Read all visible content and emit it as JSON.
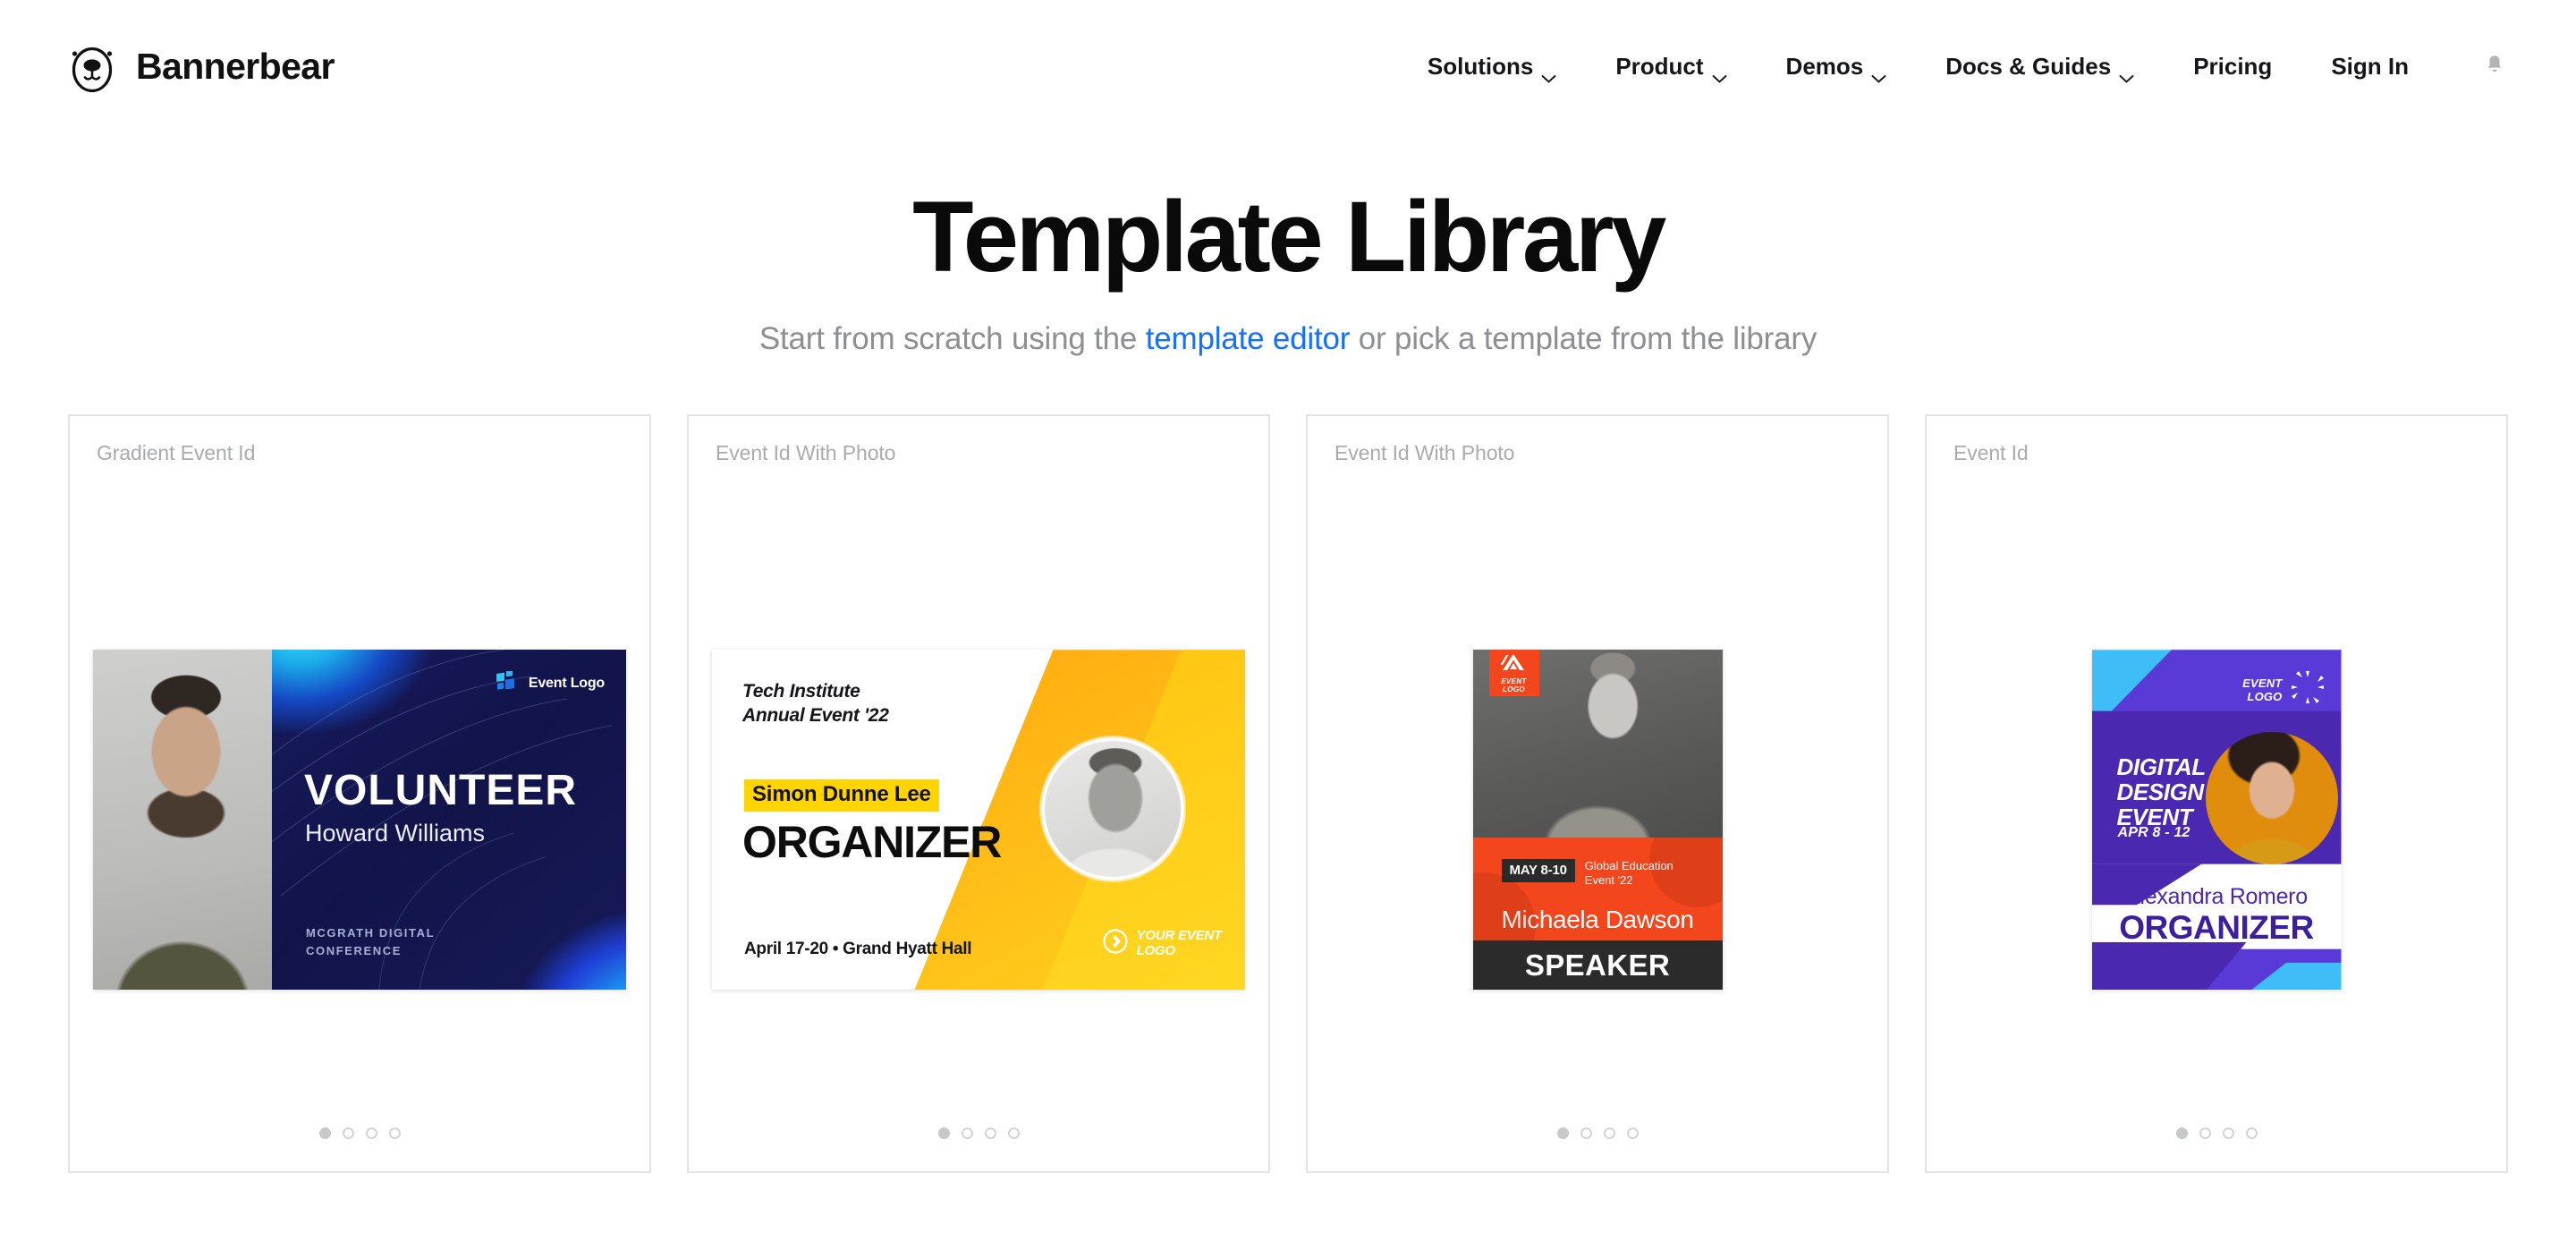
{
  "header": {
    "brand_name": "Bannerbear",
    "brand_logo_icon": "bear-head-icon",
    "nav": [
      {
        "label": "Solutions",
        "has_dropdown": true
      },
      {
        "label": "Product",
        "has_dropdown": true
      },
      {
        "label": "Demos",
        "has_dropdown": true
      },
      {
        "label": "Docs & Guides",
        "has_dropdown": true
      },
      {
        "label": "Pricing",
        "has_dropdown": false
      },
      {
        "label": "Sign In",
        "has_dropdown": false
      }
    ],
    "notification_icon": "bell-icon"
  },
  "hero": {
    "title": "Template Library",
    "subtitle_before": "Start from scratch using the ",
    "subtitle_link": "template editor",
    "subtitle_after": " or pick a template from the library"
  },
  "colors": {
    "link": "#1470ff",
    "text_primary": "#0a0a0a",
    "text_muted": "#8d8f93",
    "card_border": "#e3e4e6",
    "card_title": "#a9abae",
    "dot_active": "#c6c8ca",
    "t1_navy": "#121449",
    "t1_cyan": "#2fd4f5",
    "t2_yellow": "#ffd400",
    "t2_orange": "#ff9d0b",
    "t3_orange": "#f4461c",
    "t3_dark": "#2b2b2b",
    "t4_purple": "#4a28b0",
    "t4_violet": "#5a3ad6",
    "t4_cyan": "#3fbdf7",
    "t4_gold": "#e08c0c"
  },
  "cards": [
    {
      "title": "Gradient Event Id",
      "dots": 4,
      "active_dot": 0,
      "preview": {
        "logo_text": "Event Logo",
        "role": "VOLUNTEER",
        "name": "Howard Williams",
        "conference_line1": "MCGRATH DIGITAL",
        "conference_line2": "CONFERENCE"
      }
    },
    {
      "title": "Event Id With Photo",
      "dots": 4,
      "active_dot": 0,
      "preview": {
        "event_line1": "Tech Institute",
        "event_line2": "Annual Event '22",
        "name": "Simon Dunne Lee",
        "role": "ORGANIZER",
        "date_venue": "April 17-20 • Grand Hyatt Hall",
        "logo_line1": "YOUR EVENT",
        "logo_line2": "LOGO"
      }
    },
    {
      "title": "Event Id With Photo",
      "dots": 4,
      "active_dot": 0,
      "preview": {
        "badge_line1": "EVENT",
        "badge_line2": "LOGO",
        "date": "MAY 8-10",
        "sub_line1": "Global Education",
        "sub_line2": "Event '22",
        "name": "Michaela Dawson",
        "role": "SPEAKER"
      }
    },
    {
      "title": "Event Id",
      "dots": 4,
      "active_dot": 0,
      "preview": {
        "logo_line1": "EVENT",
        "logo_line2": "LOGO",
        "title_line1": "DIGITAL",
        "title_line2": "DESIGN",
        "title_line3": "EVENT",
        "date": "APR 8 - 12",
        "name": "Alexandra Romero",
        "role": "ORGANIZER"
      }
    }
  ]
}
